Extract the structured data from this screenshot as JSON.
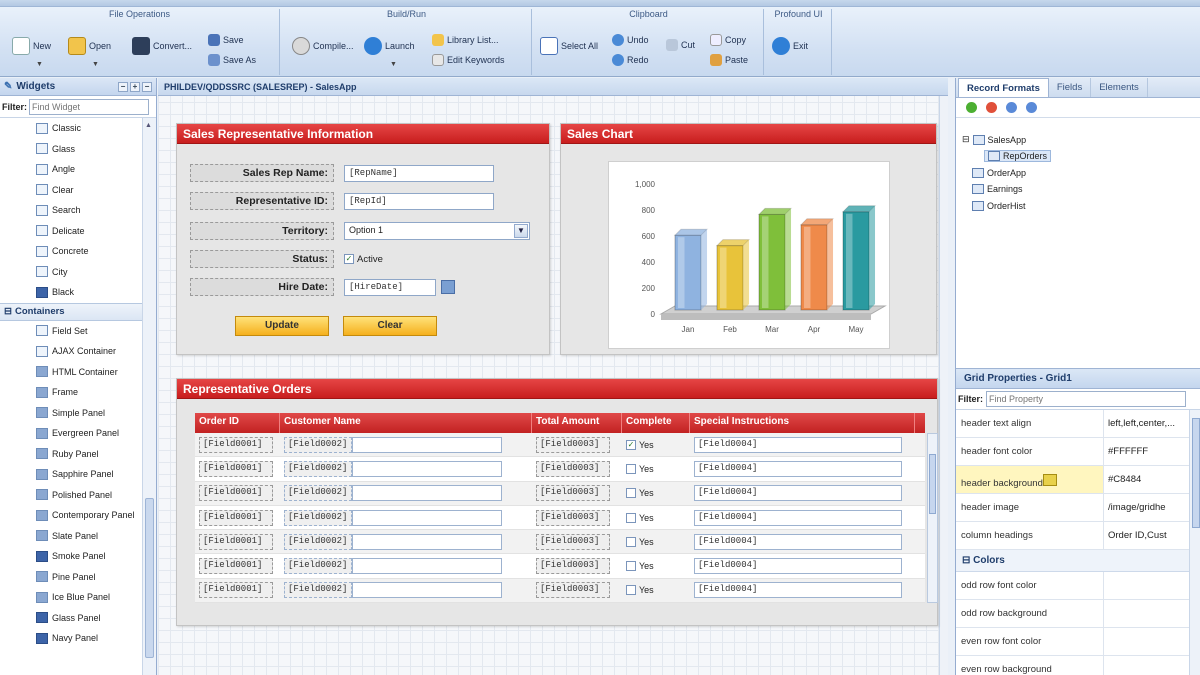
{
  "ribbon": {
    "groups": [
      {
        "title": "File Operations",
        "buttons": [
          "New",
          "Open",
          "Convert...",
          "Save",
          "Save As"
        ]
      },
      {
        "title": "Build/Run",
        "buttons": [
          "Compile...",
          "Launch",
          "Library List...",
          "Edit Keywords"
        ]
      },
      {
        "title": "Clipboard",
        "buttons": [
          "Select All",
          "Undo",
          "Redo",
          "Cut",
          "Copy",
          "Paste"
        ]
      },
      {
        "title": "Profound UI",
        "buttons": [
          "Exit"
        ]
      }
    ]
  },
  "widgets": {
    "title": "Widgets",
    "filter_label": "Filter:",
    "filter_placeholder": "Find Widget",
    "items_top": [
      "Classic",
      "Glass",
      "Angle",
      "Clear",
      "Search",
      "Delicate",
      "Concrete",
      "City",
      "Black"
    ],
    "section": "Containers",
    "items_containers": [
      "Field Set",
      "AJAX Container",
      "HTML Container",
      "Frame",
      "Simple Panel",
      "Evergreen Panel",
      "Ruby Panel",
      "Sapphire Panel",
      "Polished Panel",
      "Contemporary Panel",
      "Slate Panel",
      "Smoke Panel",
      "Pine Panel",
      "Ice Blue Panel",
      "Glass Panel",
      "Navy Panel"
    ]
  },
  "canvas": {
    "title": "PHILDEV/QDDSSRC (SALESREP) - SalesApp"
  },
  "sales_info": {
    "title": "Sales Representative Information",
    "fields": [
      {
        "label": "Sales Rep Name:",
        "value": "[RepName]"
      },
      {
        "label": "Representative ID:",
        "value": "[RepId]"
      },
      {
        "label": "Territory:",
        "value": "Option 1"
      },
      {
        "label": "Status:",
        "value": "Active"
      },
      {
        "label": "Hire Date:",
        "value": "[HireDate]"
      }
    ],
    "update_button": "Update",
    "clear_button": "Clear"
  },
  "sales_chart": {
    "title": "Sales Chart"
  },
  "chart_data": {
    "type": "bar",
    "categories": [
      "Jan",
      "Feb",
      "Mar",
      "Apr",
      "May"
    ],
    "values": [
      560,
      480,
      720,
      640,
      740
    ],
    "ylim": [
      0,
      1000
    ],
    "yticks": [
      "0",
      "200",
      "400",
      "600",
      "800",
      "1,000"
    ],
    "colors": [
      "#8fb3e0",
      "#e8c33a",
      "#7fbf3a",
      "#ef8a4a",
      "#2a9aa0"
    ]
  },
  "orders": {
    "title": "Representative Orders",
    "columns": [
      "Order ID",
      "Customer Name",
      "Total Amount",
      "Complete",
      "Special Instructions"
    ],
    "rows": [
      {
        "id": "[Field0001]",
        "name": "[Field0002]",
        "amount": "[Field0003]",
        "complete": "Yes",
        "checked": true,
        "instructions": "[Field0004]"
      },
      {
        "id": "[Field0001]",
        "name": "[Field0002]",
        "amount": "[Field0003]",
        "complete": "Yes",
        "checked": false,
        "instructions": "[Field0004]"
      },
      {
        "id": "[Field0001]",
        "name": "[Field0002]",
        "amount": "[Field0003]",
        "complete": "Yes",
        "checked": false,
        "instructions": "[Field0004]"
      },
      {
        "id": "[Field0001]",
        "name": "[Field0002]",
        "amount": "[Field0003]",
        "complete": "Yes",
        "checked": false,
        "instructions": "[Field0004]"
      },
      {
        "id": "[Field0001]",
        "name": "[Field0002]",
        "amount": "[Field0003]",
        "complete": "Yes",
        "checked": false,
        "instructions": "[Field0004]"
      },
      {
        "id": "[Field0001]",
        "name": "[Field0002]",
        "amount": "[Field0003]",
        "complete": "Yes",
        "checked": false,
        "instructions": "[Field0004]"
      },
      {
        "id": "[Field0001]",
        "name": "[Field0002]",
        "amount": "[Field0003]",
        "complete": "Yes",
        "checked": false,
        "instructions": "[Field0004]"
      }
    ]
  },
  "right": {
    "tabs": [
      "Record Formats",
      "Fields",
      "Elements"
    ],
    "tree": [
      "SalesApp",
      "RepOrders",
      "OrderApp",
      "Earnings",
      "OrderHist"
    ],
    "gridprops": {
      "title": "Grid Properties - Grid1",
      "filter_label": "Filter:",
      "filter_placeholder": "Find Property",
      "rows": [
        {
          "k": "header text align",
          "v": "left,left,center,..."
        },
        {
          "k": "header font color",
          "v": "#FFFFFF"
        },
        {
          "k": "header background",
          "v": "#C8484"
        },
        {
          "k": "header image",
          "v": "/image/gridhe"
        },
        {
          "k": "column headings",
          "v": "Order ID,Cust"
        }
      ],
      "section": "Colors",
      "color_rows": [
        "odd row font color",
        "odd row background",
        "even row font color",
        "even row background"
      ]
    }
  }
}
